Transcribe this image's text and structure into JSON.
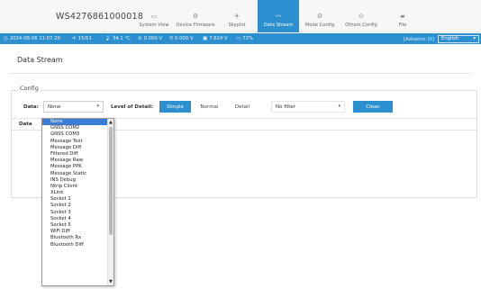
{
  "header": {
    "serial": "WS4276861000018",
    "nav": [
      {
        "label": "System View",
        "icon": "monitor-icon",
        "glyph": "▭"
      },
      {
        "label": "Device Firmware",
        "icon": "gear-icon",
        "glyph": "⚙"
      },
      {
        "label": "Skyplot",
        "icon": "satellite-icon",
        "glyph": "✈"
      },
      {
        "label": "Data Stream",
        "icon": "stream-icon",
        "glyph": "〰",
        "active": true
      },
      {
        "label": "Mode Config",
        "icon": "mode-icon",
        "glyph": "⚙"
      },
      {
        "label": "Others Config",
        "icon": "config-icon",
        "glyph": "⊙"
      },
      {
        "label": "File",
        "icon": "folder-icon",
        "glyph": "▰"
      }
    ]
  },
  "status": {
    "datetime": "2024-08-06 11:07:20",
    "satellites": "15/51",
    "temperature": "34.1 °C",
    "voltage1": "0.000 V",
    "voltage2": "0.000 V",
    "voltage3": "7.624 V",
    "battery": "72%",
    "advanced": "[Advance UI]",
    "language": "English"
  },
  "page": {
    "title": "Data Stream",
    "config_legend": "Config"
  },
  "controls": {
    "data_label": "Data:",
    "data_value": "None",
    "level_label": "Level of Detail:",
    "level_options": [
      "Simple",
      "Normal",
      "Detail"
    ],
    "filter_value": "No filter",
    "clean_label": "Clean"
  },
  "table": {
    "column": "Data"
  },
  "dropdown": {
    "options": [
      "None",
      "GNSS COM2",
      "GNSS COM3",
      "Message Text",
      "Message Diff",
      "Filtered Diff",
      "Message Raw",
      "Message PPK",
      "Message Static",
      "INS Debug",
      "Ntrip Client",
      "XLink",
      "Socket 1",
      "Socket 2",
      "Socket 3",
      "Socket 4",
      "Socket 5",
      "WiFi Diff",
      "Bluetooth Rx",
      "Bluetooth Diff"
    ],
    "selected_index": 0
  },
  "colors": {
    "accent": "#2b8fd0",
    "selected": "#3a7bd5"
  }
}
